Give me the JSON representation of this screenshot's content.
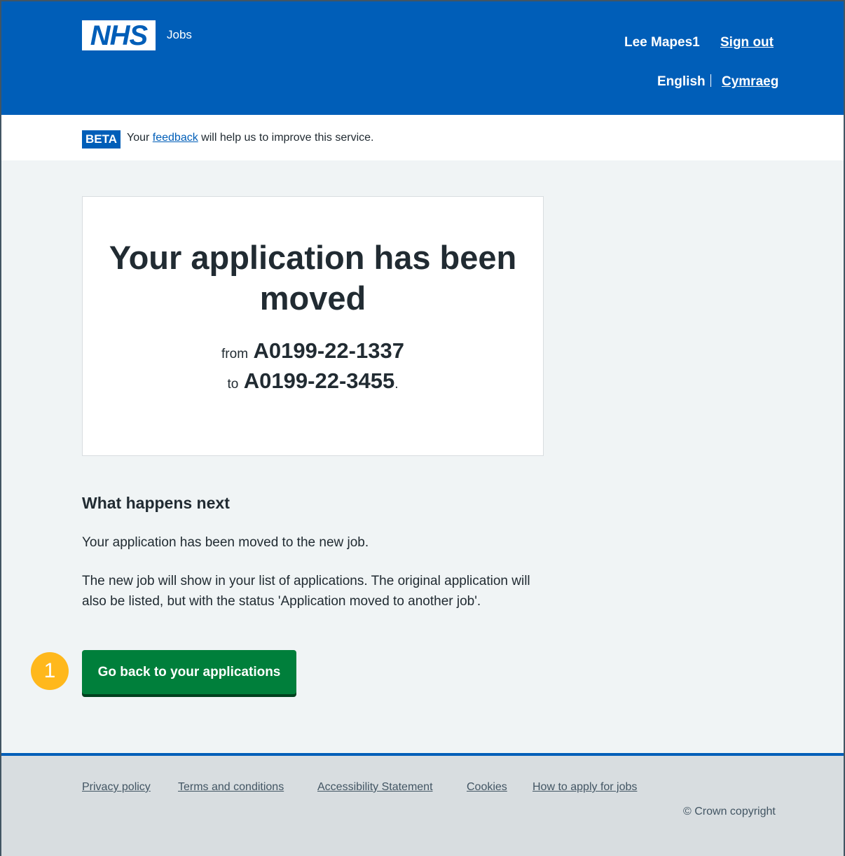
{
  "header": {
    "logo_text": "NHS",
    "service_name": "Jobs",
    "user_name": "Lee Mapes1",
    "sign_out": "Sign out",
    "lang_current": "English",
    "lang_other": "Cymraeg"
  },
  "beta": {
    "tag": "BETA",
    "text_before": "Your",
    "link": "feedback",
    "text_after": "will help us to improve this service."
  },
  "panel": {
    "title": "Your application has been moved",
    "from_label": "from",
    "from_ref": "A0199-22-1337",
    "to_label": "to",
    "to_ref": "A0199-22-3455",
    "end_punct": "."
  },
  "next": {
    "heading": "What happens next",
    "para1": "Your application has been moved to the new job.",
    "para2": "The new job will show in your list of applications. The original application will also be listed, but with the status 'Application moved to another job'."
  },
  "marker_number": "1",
  "button_label": "Go back to your applications",
  "footer": {
    "links": [
      "Privacy policy",
      "Terms and conditions",
      "Accessibility Statement",
      "Cookies",
      "How to apply for jobs"
    ],
    "copyright": "© Crown copyright"
  },
  "colors": {
    "header_blue": "#005eb8",
    "button_green": "#007f3b",
    "marker_yellow": "#ffb81c",
    "page_bg": "#f0f4f5",
    "footer_bg": "#d8dde0"
  }
}
